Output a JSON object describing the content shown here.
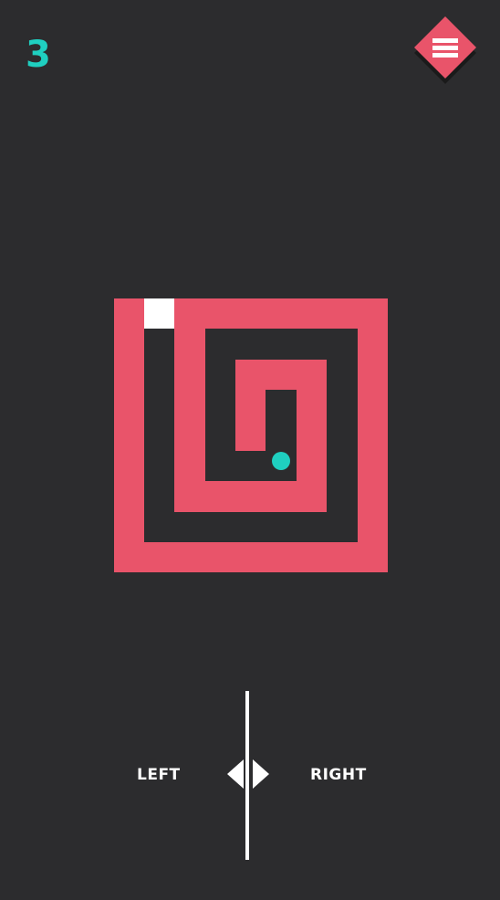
{
  "hud": {
    "level": "3"
  },
  "menu": {
    "icon": "hamburger-menu-icon"
  },
  "maze": {
    "wall_color": "#e9546a",
    "ball_color": "#1fcfc0",
    "exit_color": "#ffffff"
  },
  "controls": {
    "left_label": "LEFT",
    "right_label": "RIGHT",
    "icon": "left-right-arrows-icon"
  },
  "colors": {
    "background": "#2c2c2e",
    "accent": "#e9546a",
    "score": "#1fcfc0"
  }
}
